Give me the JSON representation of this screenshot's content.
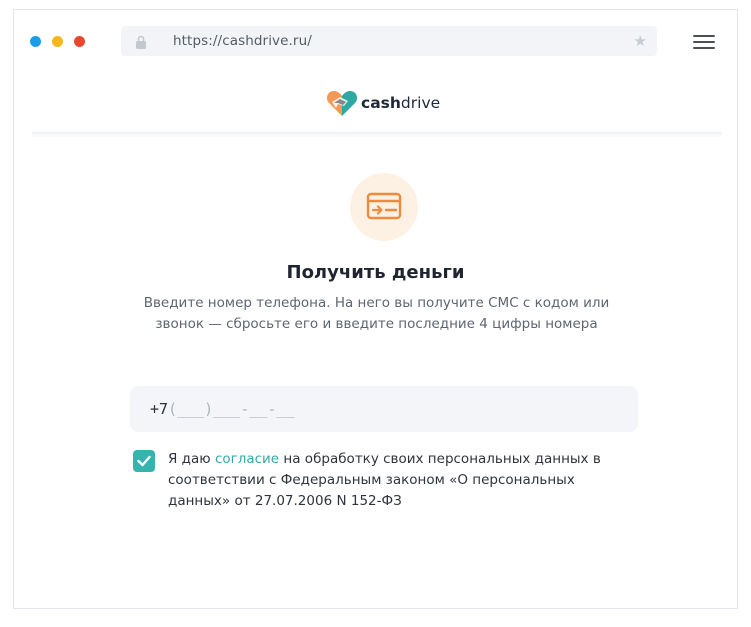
{
  "browser": {
    "url": "https://cashdrive.ru/",
    "dots": [
      {
        "name": "blue",
        "color": "#1e9be8"
      },
      {
        "name": "yellow",
        "color": "#f5b81c"
      },
      {
        "name": "red",
        "color": "#e5482f"
      }
    ],
    "icons": {
      "lock": "lock-icon",
      "bookmark": "star-icon",
      "menu": "hamburger-menu-icon"
    }
  },
  "header": {
    "logo_bold": "cash",
    "logo_regular": "drive",
    "colors": {
      "logo_orange": "#f29a55",
      "logo_teal": "#2fa8a2",
      "logo_dark": "#2a3442"
    }
  },
  "main": {
    "title": "Получить деньги",
    "description": "Введите номер телефона. На него вы получите СМС с кодом или звонок — сбросьте его и введите последние 4 цифры номера",
    "icon": "card-transfer-icon",
    "phone": {
      "prefix": "+7",
      "mask": "(___)___-__-__"
    },
    "consent": {
      "checked": true,
      "text_before": "Я даю ",
      "link_text": "согласие",
      "text_after": " на обработку своих персональных данных в соответствии с Федеральным законом «О персональных данных» от 27.07.2006 N 152-ФЗ"
    },
    "colors": {
      "accent": "#37b3ad",
      "icon_bg": "#fdf1e3",
      "icon_fg": "#f28a3c"
    }
  }
}
